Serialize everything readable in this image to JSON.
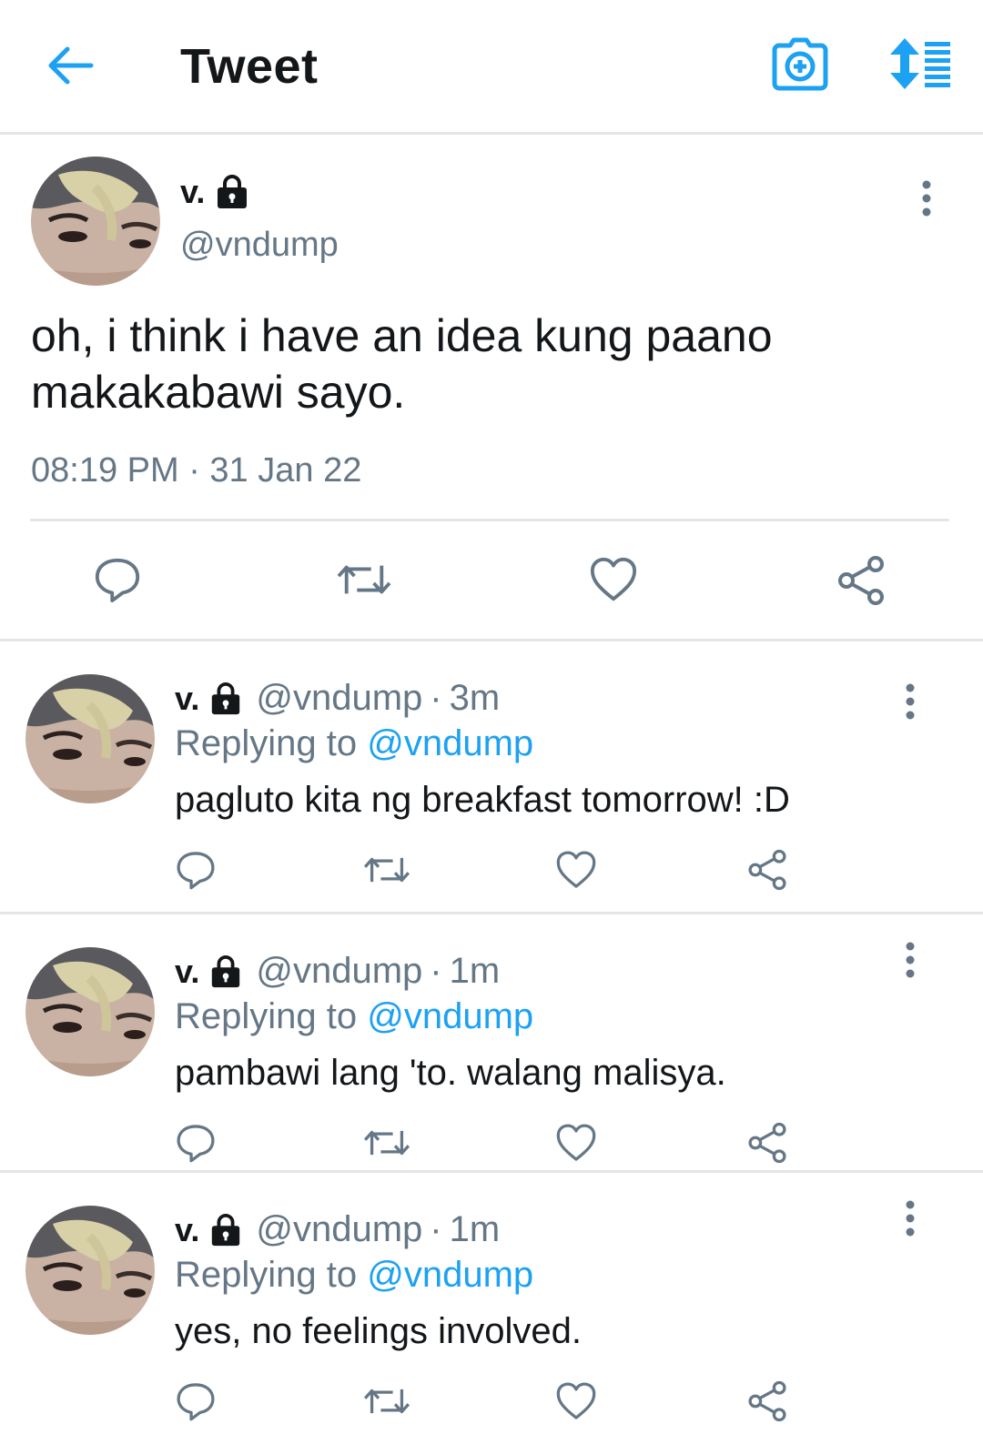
{
  "header": {
    "title": "Tweet",
    "accent_color": "#1da1f2",
    "icons": [
      "back-arrow-icon",
      "camera-plus-icon",
      "sort-icon"
    ]
  },
  "main_tweet": {
    "name": "v.",
    "handle": "@vndump",
    "text": "oh, i think i have an idea kung paano makakabawi sayo.",
    "timestamp": "08:19 PM · 31 Jan 22",
    "icons": [
      "reply-icon",
      "retweet-icon",
      "like-icon",
      "share-icon"
    ]
  },
  "replies": [
    {
      "name": "v.",
      "handle": "@vndump",
      "separator": "·",
      "time": "3m",
      "replying_prefix": "Replying to",
      "replying_to": "@vndump",
      "text": "pagluto kita ng breakfast tomorrow! :D"
    },
    {
      "name": "v.",
      "handle": "@vndump",
      "separator": "·",
      "time": "1m",
      "replying_prefix": "Replying to",
      "replying_to": "@vndump",
      "text": "pambawi lang 'to. walang malisya."
    },
    {
      "name": "v.",
      "handle": "@vndump",
      "separator": "·",
      "time": "1m",
      "replying_prefix": "Replying to",
      "replying_to": "@vndump",
      "text": "yes, no feelings involved."
    }
  ]
}
